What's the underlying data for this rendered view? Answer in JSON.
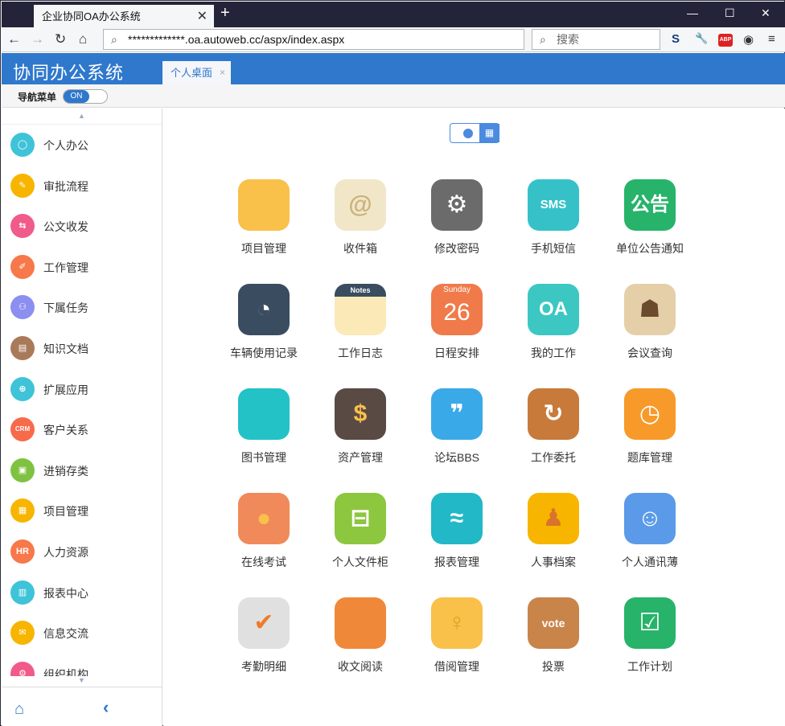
{
  "browser": {
    "tab_title": "企业协同OA办公系统",
    "tab_close": "✕",
    "new_tab": "+",
    "url": "*************.oa.autoweb.cc/aspx/index.aspx",
    "search_placeholder": "搜索",
    "ext_abp": "ABP"
  },
  "app": {
    "logo": "协同办公系统",
    "tab_label": "个人桌面",
    "tab_close": "×",
    "nav_label": "导航菜单",
    "toggle_label": "ON"
  },
  "sidebar": {
    "items": [
      {
        "label": "个人办公",
        "icon": "user-icon",
        "color": "#3ec3d8",
        "glyph": "◯"
      },
      {
        "label": "审批流程",
        "icon": "approve-icon",
        "color": "#f7b500",
        "glyph": "✎"
      },
      {
        "label": "公文收发",
        "icon": "document-exchange-icon",
        "color": "#f05b8a",
        "glyph": "⇆"
      },
      {
        "label": "工作管理",
        "icon": "work-icon",
        "color": "#f7784a",
        "glyph": "✐"
      },
      {
        "label": "下属任务",
        "icon": "team-icon",
        "color": "#8b8ff0",
        "glyph": "⚇"
      },
      {
        "label": "知识文档",
        "icon": "book-icon",
        "color": "#a97a5a",
        "glyph": "▤"
      },
      {
        "label": "扩展应用",
        "icon": "extend-icon",
        "color": "#3ec3d8",
        "glyph": "⊕"
      },
      {
        "label": "客户关系",
        "icon": "crm-icon",
        "color": "#f76a4a",
        "glyph": "CRM"
      },
      {
        "label": "进销存类",
        "icon": "inventory-icon",
        "color": "#7fc242",
        "glyph": "▣"
      },
      {
        "label": "项目管理",
        "icon": "project-icon",
        "color": "#f7b500",
        "glyph": "▦"
      },
      {
        "label": "人力资源",
        "icon": "hr-icon",
        "color": "#f7784a",
        "glyph": "HR"
      },
      {
        "label": "报表中心",
        "icon": "report-icon",
        "color": "#3ec3d8",
        "glyph": "▥"
      },
      {
        "label": "信息交流",
        "icon": "message-icon",
        "color": "#f7b500",
        "glyph": "✉"
      },
      {
        "label": "组织机构",
        "icon": "org-icon",
        "color": "#f05b8a",
        "glyph": "⚙"
      }
    ]
  },
  "apps": [
    {
      "label": "项目管理",
      "icon": "notebook-icon",
      "bg": "#f9c04a",
      "glyph": ""
    },
    {
      "label": "收件箱",
      "icon": "inbox-mail-icon",
      "bg": "#f1e6c8",
      "glyph": "@",
      "fg": "#c9b27a"
    },
    {
      "label": "修改密码",
      "icon": "gear-icon",
      "bg": "#6b6b6b",
      "glyph": "⚙"
    },
    {
      "label": "手机短信",
      "icon": "sms-icon",
      "bg": "#36c1c9",
      "glyph": "SMS"
    },
    {
      "label": "单位公告通知",
      "icon": "bulletin-board-icon",
      "bg": "#27b36a",
      "glyph": "公告"
    },
    {
      "label": "车辆使用记录",
      "icon": "speedometer-icon",
      "bg": "#3a4d60",
      "glyph": "◔"
    },
    {
      "label": "工作日志",
      "icon": "notes-icon",
      "bg": "#fbe9b8",
      "glyph": "Notes",
      "fg": "#fff",
      "hdr": "#3a4d60"
    },
    {
      "label": "日程安排",
      "icon": "calendar-icon",
      "bg": "#f07a4a",
      "glyph": "26",
      "sub": "Sunday"
    },
    {
      "label": "我的工作",
      "icon": "oa-icon",
      "bg": "#3cc7c3",
      "glyph": "OA"
    },
    {
      "label": "会议查询",
      "icon": "meeting-icon",
      "bg": "#e5cfa8",
      "glyph": "☗",
      "fg": "#6b4a2e"
    },
    {
      "label": "图书管理",
      "icon": "book-icon",
      "bg": "#22c2c7",
      "glyph": ""
    },
    {
      "label": "资产管理",
      "icon": "wallet-icon",
      "bg": "#5a4a44",
      "glyph": "$",
      "fg": "#f9c04a"
    },
    {
      "label": "论坛BBS",
      "icon": "quote-bubble-icon",
      "bg": "#3aa9e8",
      "glyph": "❞"
    },
    {
      "label": "工作委托",
      "icon": "delegate-tray-icon",
      "bg": "#c77a3a",
      "glyph": "↻"
    },
    {
      "label": "题库管理",
      "icon": "clock-icon",
      "bg": "#f79a2a",
      "glyph": "◷"
    },
    {
      "label": "在线考试",
      "icon": "medal-icon",
      "bg": "#f08a5a",
      "glyph": "●",
      "fg": "#f9c04a"
    },
    {
      "label": "个人文件柜",
      "icon": "cabinet-icon",
      "bg": "#8dc63f",
      "glyph": "⊟"
    },
    {
      "label": "报表管理",
      "icon": "wave-chart-icon",
      "bg": "#22b8c7",
      "glyph": "≈"
    },
    {
      "label": "人事档案",
      "icon": "personnel-file-icon",
      "bg": "#f7b500",
      "glyph": "♟",
      "fg": "#d9742a"
    },
    {
      "label": "个人通讯薄",
      "icon": "contacts-icon",
      "bg": "#5b9ae8",
      "glyph": "☺"
    },
    {
      "label": "考勤明细",
      "icon": "attendance-icon",
      "bg": "#e0e0e0",
      "glyph": "✔",
      "fg": "#f07a2a"
    },
    {
      "label": "收文阅读",
      "icon": "reading-icon",
      "bg": "#f0883a",
      "glyph": ""
    },
    {
      "label": "借阅管理",
      "icon": "lend-tray-icon",
      "bg": "#f9c04a",
      "glyph": "♀",
      "fg": "#e0a020"
    },
    {
      "label": "投票",
      "icon": "vote-box-icon",
      "bg": "#c9844a",
      "glyph": "vote"
    },
    {
      "label": "工作计划",
      "icon": "clipboard-icon",
      "bg": "#27b36a",
      "glyph": "☑"
    }
  ]
}
